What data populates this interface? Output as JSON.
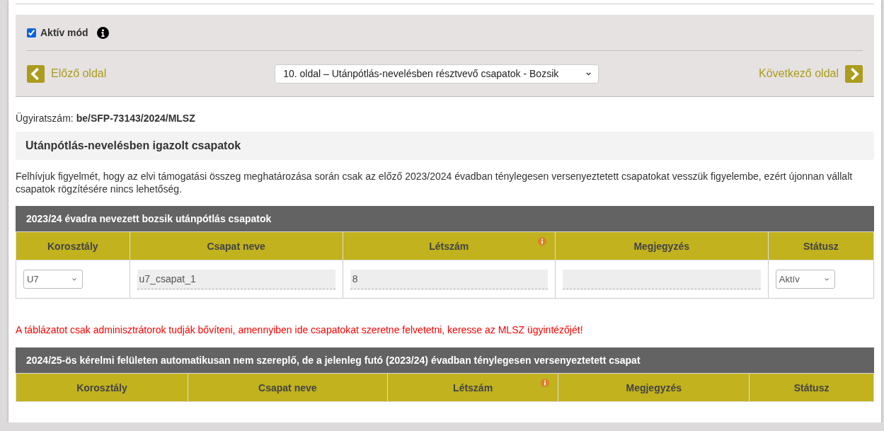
{
  "active_mode": {
    "label": "Aktív mód",
    "checked": true
  },
  "nav": {
    "prev": "Előző oldal",
    "page_select": "10. oldal – Utánpótlás-nevelésben résztvevő csapatok - Bozsik",
    "next": "Következő oldal"
  },
  "case_number": {
    "label": "Ügyiratszám:",
    "value": "be/SFP-73143/2024/MLSZ"
  },
  "section_title": "Utánpótlás-nevelésben igazolt csapatok",
  "notice": "Felhívjuk figyelmét, hogy az elvi támogatási összeg meghatározása során csak az előző 2023/2024 évadban ténylegesen versenyeztetett csapatokat vesszük figyelembe, ezért újonnan vállalt csapatok rögzítésére nincs lehetőség.",
  "table_1": {
    "title": "2023/24 évadra nevezett bozsik utánpótlás csapatok",
    "columns": [
      {
        "label": "Korosztály",
        "info": false
      },
      {
        "label": "Csapat neve",
        "info": false
      },
      {
        "label": "Létszám",
        "info": true
      },
      {
        "label": "Megjegyzés",
        "info": false
      },
      {
        "label": "Státusz",
        "info": false
      }
    ],
    "rows": [
      {
        "cells": [
          {
            "kind": "select",
            "value": "U7"
          },
          {
            "kind": "input",
            "value": "u7_csapat_1"
          },
          {
            "kind": "input",
            "value": "8"
          },
          {
            "kind": "input"
          },
          {
            "kind": "select",
            "value": "Aktív"
          }
        ]
      }
    ]
  },
  "admin_warning": "A táblázatot csak adminisztrátorok tudják bővíteni, amennyiben ide csapatokat szeretne felvetetni, keresse az MLSZ ügyintézőjét!",
  "table_2": {
    "title": "2024/25-ös kérelmi felületen automatikusan nem szereplő, de a jelenleg futó (2023/24) évadban ténylegesen versenyeztetett csapat",
    "columns": [
      {
        "label": "Korosztály",
        "info": false
      },
      {
        "label": "Csapat neve",
        "info": false
      },
      {
        "label": "Létszám",
        "info": true
      },
      {
        "label": "Megjegyzés",
        "info": false
      },
      {
        "label": "Státusz",
        "info": false
      }
    ]
  }
}
